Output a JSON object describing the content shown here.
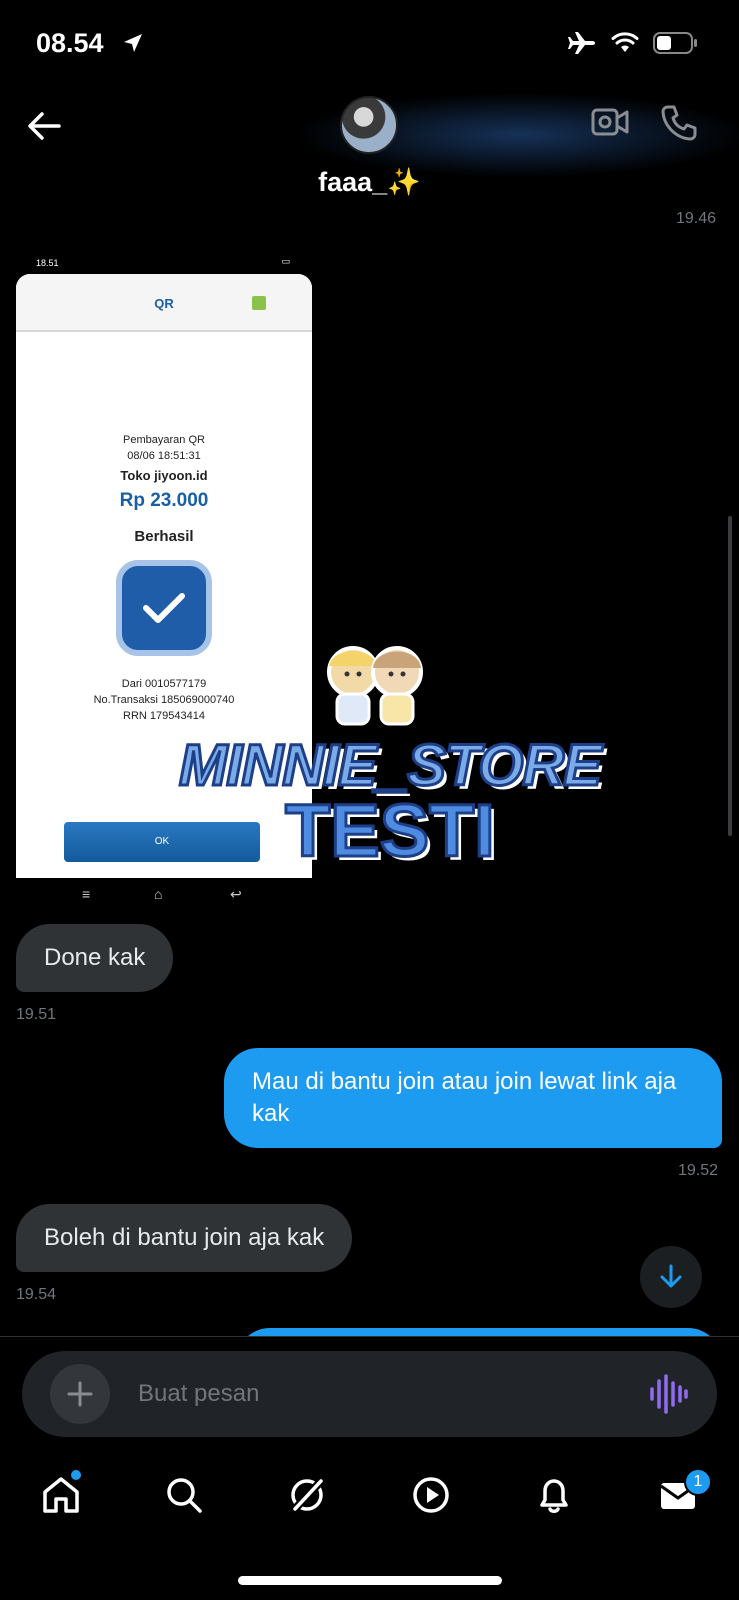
{
  "status_bar": {
    "time": "08.54"
  },
  "header": {
    "contact_name": "faaa_✨",
    "top_timestamp": "19.46"
  },
  "screenshot": {
    "status_time": "18.51",
    "title": "QR",
    "payment_label": "Pembayaran QR",
    "payment_datetime": "08/06 18:51:31",
    "merchant": "Toko jiyoon.id",
    "amount": "Rp 23.000",
    "status": "Berhasil",
    "from": "Dari 0010577179",
    "transaction": "No.Transaksi 185069000740",
    "rrn": "RRN 179543414",
    "ok_label": "OK"
  },
  "watermark": {
    "line1": "MINNIE_STORE",
    "line2": "TESTI"
  },
  "messages": [
    {
      "direction": "in",
      "text": "Done kak",
      "time": "19.51"
    },
    {
      "direction": "out",
      "text": "Mau di bantu join atau join lewat link aja kak",
      "time": "19.52"
    },
    {
      "direction": "in",
      "text": "Boleh di bantu join aja kak",
      "time": "19.54"
    }
  ],
  "composer": {
    "placeholder": "Buat pesan"
  },
  "nav": {
    "messages_badge": "1"
  },
  "colors": {
    "accent": "#1d9bf0",
    "incoming_bubble": "#2f3336",
    "background": "#000000",
    "voice": "#8f6cf0"
  }
}
